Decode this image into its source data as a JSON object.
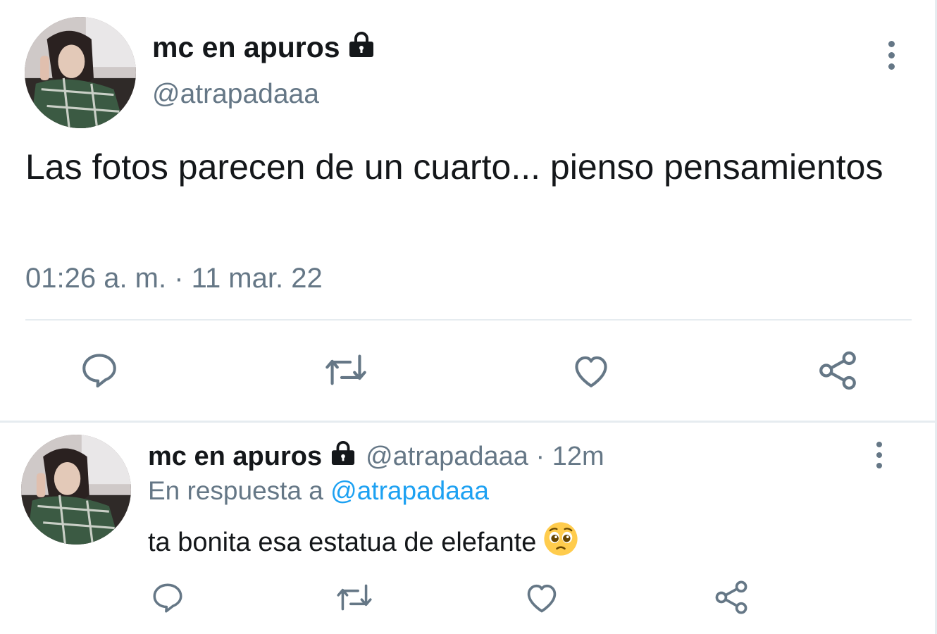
{
  "main_tweet": {
    "display_name": "mc en apuros",
    "handle": "@atrapadaaa",
    "text": "Las fotos parecen de un cuarto... pienso pensamientos",
    "timestamp": "01:26 a. m. · 11 mar. 22",
    "icons": {
      "lock": "lock-icon",
      "more": "more-vertical-icon",
      "reply": "reply-icon",
      "retweet": "retweet-icon",
      "like": "heart-icon",
      "share": "share-icon"
    }
  },
  "reply_tweet": {
    "display_name": "mc en apuros",
    "handle": "@atrapadaaa",
    "age": "12m",
    "separator": "·",
    "reply_context_prefix": "En respuesta a",
    "reply_context_mention": "@atrapadaaa",
    "text": "ta bonita esa estatua de elefante",
    "emoji": "pleading-face-emoji"
  },
  "colors": {
    "text_primary": "#14171a",
    "text_secondary": "#657786",
    "mention": "#1da1f2",
    "divider": "#e6ecf0"
  }
}
